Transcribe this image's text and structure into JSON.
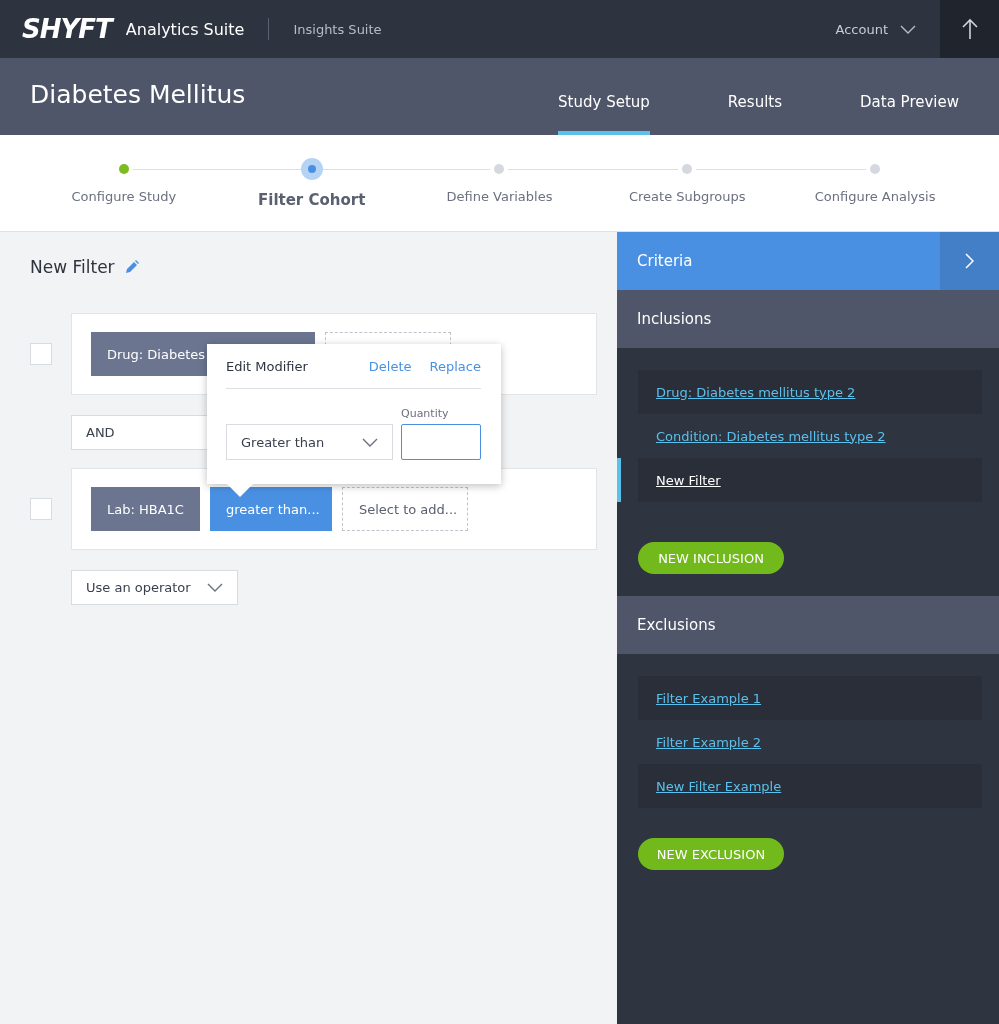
{
  "topbar": {
    "logo": "SHYFT",
    "product": "Analytics Suite",
    "secondary": "Insights Suite",
    "account": "Account"
  },
  "header": {
    "title": "Diabetes Mellitus",
    "tabs": [
      {
        "label": "Study Setup",
        "selected": true
      },
      {
        "label": "Results",
        "selected": false
      },
      {
        "label": "Data Preview",
        "selected": false
      }
    ]
  },
  "steps": [
    {
      "label": "Configure Study",
      "kind": "done"
    },
    {
      "label": "Filter Cohort",
      "kind": "current"
    },
    {
      "label": "Define Variables",
      "kind": "pending"
    },
    {
      "label": "Create Subgroups",
      "kind": "pending"
    },
    {
      "label": "Configure Analysis",
      "kind": "pending"
    }
  ],
  "filter": {
    "title": "New Filter",
    "rows": [
      {
        "checked": false,
        "chips": [
          {
            "kind": "criterion",
            "label": "Drug: Diabetes"
          },
          {
            "kind": "placeholder"
          }
        ]
      },
      {
        "checked": false,
        "chips": [
          {
            "kind": "criterion",
            "label": "Lab: HBA1C"
          },
          {
            "kind": "modifier",
            "label": "greater than...",
            "selected": true
          },
          {
            "kind": "placeholder",
            "label": "Select to add..."
          }
        ]
      }
    ],
    "operator": "AND",
    "add_operator": "Use an operator"
  },
  "popover": {
    "title": "Edit Modifier",
    "actions": [
      "Delete",
      "Replace"
    ],
    "comparison": "Greater than",
    "quantity_label": "Quantity"
  },
  "criteria": {
    "title": "Criteria",
    "inclusions": {
      "title": "Inclusions",
      "items": [
        {
          "label": "Drug: Diabetes mellitus type 2",
          "selected": false
        },
        {
          "label": "Condition: Diabetes mellitus type 2",
          "selected": false
        },
        {
          "label": "New Filter",
          "selected": true
        }
      ],
      "button": "NEW INCLUSION"
    },
    "exclusions": {
      "title": "Exclusions",
      "items": [
        {
          "label": "Filter Example 1",
          "selected": false
        },
        {
          "label": "Filter Example 2",
          "selected": false
        },
        {
          "label": "New Filter Example",
          "selected": false
        }
      ],
      "button": "NEW EXCLUSION"
    }
  }
}
